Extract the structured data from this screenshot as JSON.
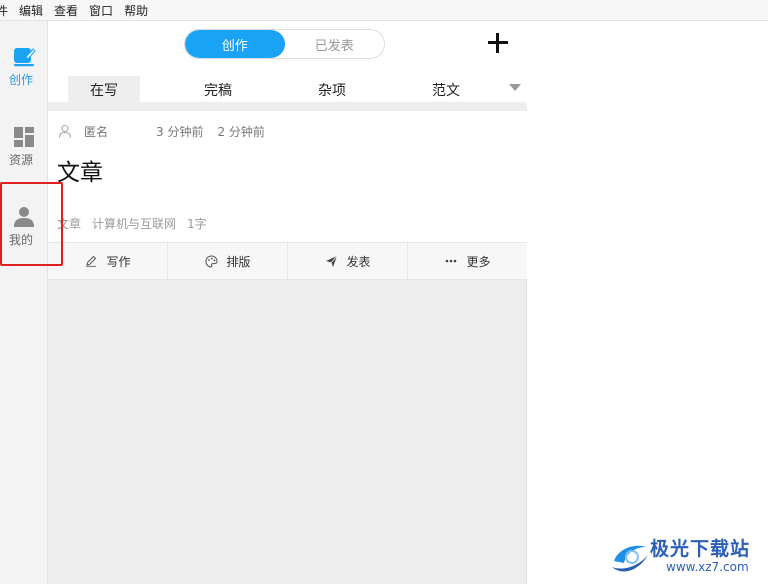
{
  "menubar": {
    "items": [
      "件",
      "编辑",
      "查看",
      "窗口",
      "帮助"
    ]
  },
  "sidebar": {
    "items": [
      {
        "label": "创作",
        "icon": "compose-icon",
        "active": true
      },
      {
        "label": "资源",
        "icon": "grid-icon",
        "active": false
      },
      {
        "label": "我的",
        "icon": "user-icon",
        "active": false
      }
    ]
  },
  "segment": {
    "left": "创作",
    "right": "已发表"
  },
  "tabs": [
    "在写",
    "完稿",
    "杂项",
    "范文"
  ],
  "card": {
    "author": "匿名",
    "time1": "3 分钟前",
    "time2": "2 分钟前",
    "title": "文章",
    "tags": [
      "文章",
      "计算机与互联网",
      "1字"
    ]
  },
  "actions": [
    "写作",
    "排版",
    "发表",
    "更多"
  ],
  "watermark": {
    "text": "极光下载站",
    "url": "www.xz7.com"
  },
  "colors": {
    "accent": "#1aa3f5",
    "highlight": "#e02020",
    "watermark": "#2a5fb8"
  }
}
